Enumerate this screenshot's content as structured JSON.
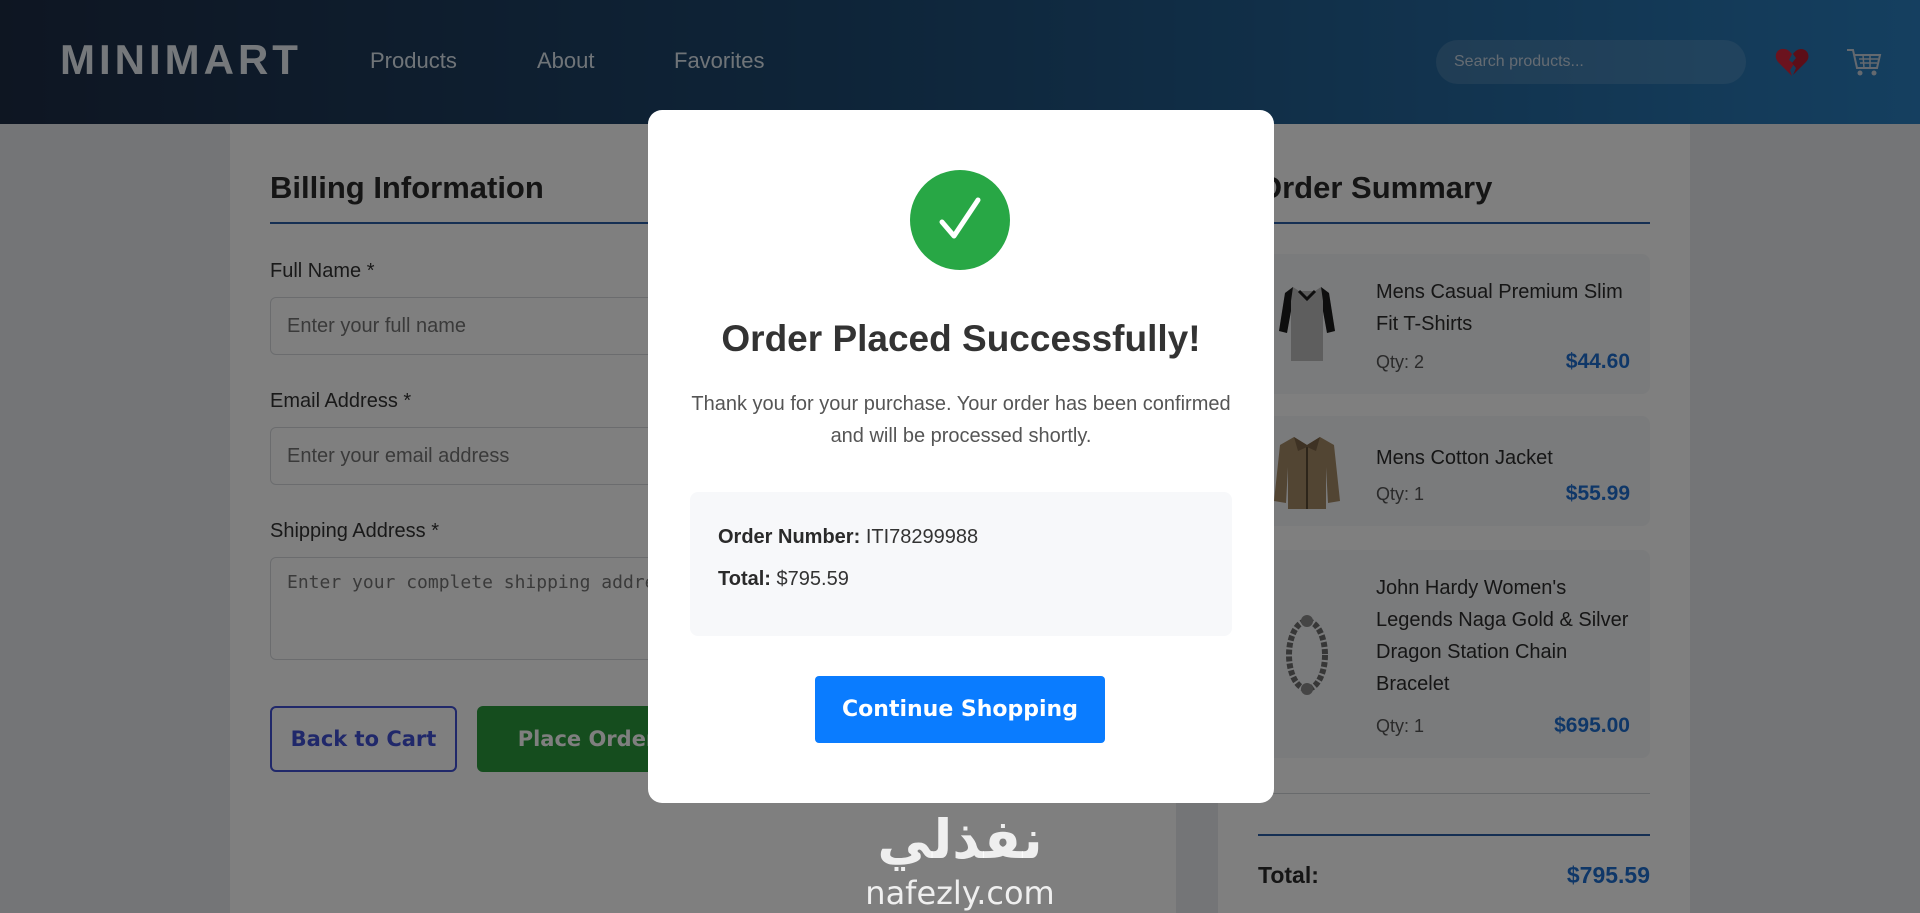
{
  "header": {
    "logo": "MINIMART",
    "nav": [
      "Products",
      "About",
      "Favorites"
    ],
    "search_placeholder": "Search products...",
    "icons": [
      "broken-heart-icon",
      "cart-icon"
    ]
  },
  "billing": {
    "title": "Billing Information",
    "full_name_label": "Full Name *",
    "full_name_placeholder": "Enter your full name",
    "email_label": "Email Address *",
    "email_placeholder": "Enter your email address",
    "address_label": "Shipping Address *",
    "address_placeholder": "Enter your complete shipping address",
    "back_button": "Back to Cart",
    "place_button": "Place Order"
  },
  "summary": {
    "title": "Order Summary",
    "items": [
      {
        "name": "Mens Casual Premium Slim Fit T-Shirts",
        "qty": "Qty: 2",
        "price": "$44.60",
        "icon": "tshirt-icon"
      },
      {
        "name": "Mens Cotton Jacket",
        "qty": "Qty: 1",
        "price": "$55.99",
        "icon": "jacket-icon"
      },
      {
        "name": "John Hardy Women's Legends Naga Gold & Silver Dragon Station Chain Bracelet",
        "qty": "Qty: 1",
        "price": "$695.00",
        "icon": "bracelet-icon"
      }
    ],
    "total_label": "Total:",
    "total_value": "$795.59"
  },
  "modal": {
    "icon": "checkmark-icon",
    "title": "Order Placed Successfully!",
    "message": "Thank you for your purchase. Your order has been confirmed and will be processed shortly.",
    "order_number_label": "Order Number:",
    "order_number": "ITI78299988",
    "total_label": "Total:",
    "total_value": "$795.59",
    "continue_button": "Continue Shopping"
  },
  "watermark": {
    "arabic": "نفذلي",
    "latin": "nafezly.com"
  },
  "colors": {
    "accent_blue": "#1e6fd0",
    "success_green": "#28a745",
    "button_blue": "#0a7cff"
  }
}
